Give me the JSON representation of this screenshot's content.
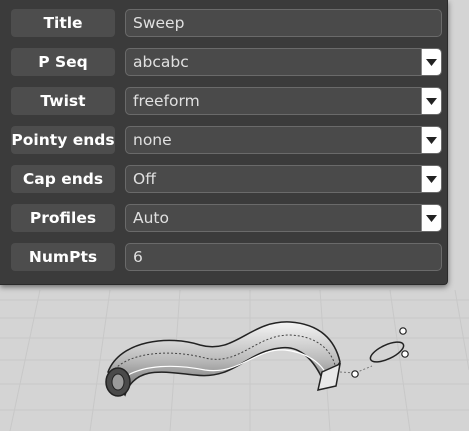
{
  "panel": {
    "rows": [
      {
        "label": "Title",
        "type": "text",
        "value": "Sweep"
      },
      {
        "label": "P Seq",
        "type": "select",
        "value": "abcabc"
      },
      {
        "label": "Twist",
        "type": "select",
        "value": "freeform"
      },
      {
        "label": "Pointy ends",
        "type": "select",
        "value": "none"
      },
      {
        "label": "Cap ends",
        "type": "select",
        "value": "Off"
      },
      {
        "label": "Profiles",
        "type": "select",
        "value": "Auto"
      },
      {
        "label": "NumPts",
        "type": "text",
        "value": "6"
      }
    ]
  },
  "icons": {
    "dropdown": "chevron-down-icon"
  },
  "colors": {
    "panel_bg": "#3b3b3b",
    "label_bg": "#4d4d4d",
    "field_bg": "#4a4a4a",
    "viewport_bg": "#d4d4d4"
  }
}
